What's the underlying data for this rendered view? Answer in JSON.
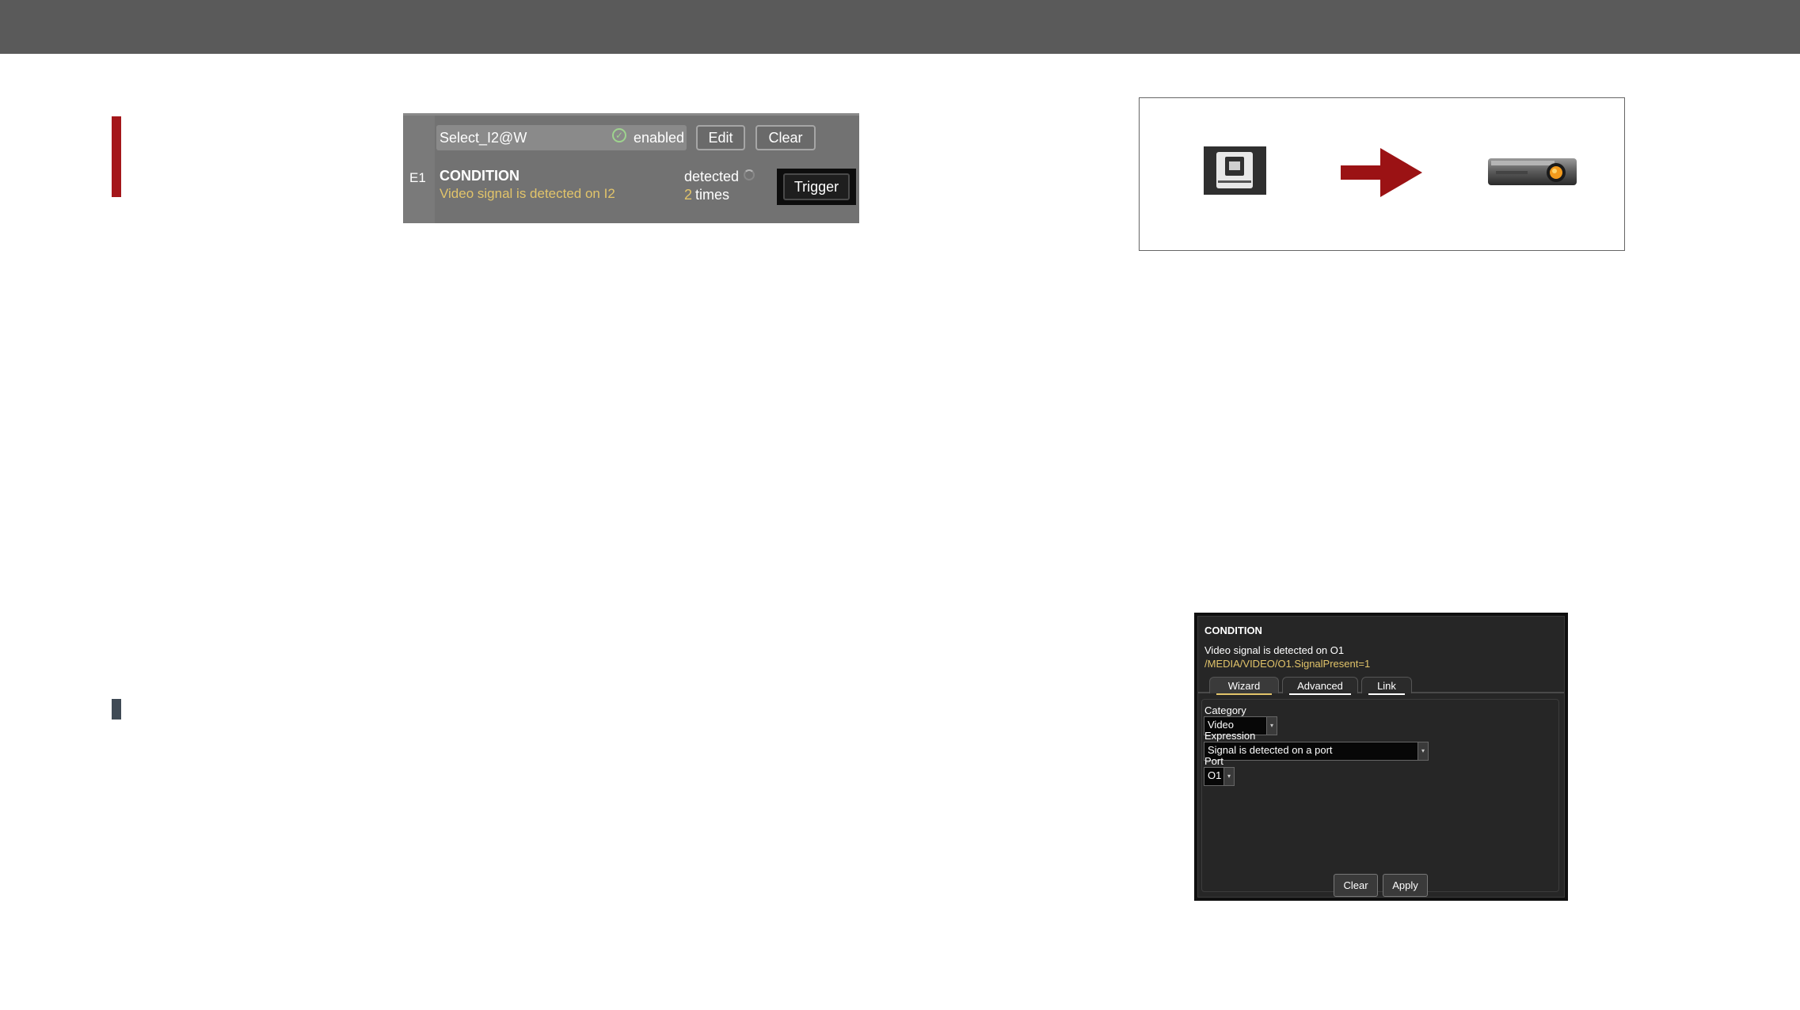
{
  "event_panel": {
    "event_name": "Select_I2@W",
    "status_label": "enabled",
    "edit_label": "Edit",
    "clear_label": "Clear",
    "event_id": "E1",
    "condition_title": "CONDITION",
    "condition_description": "Video signal is detected on I2",
    "detected_label": "detected",
    "detected_count": "2",
    "times_label": "times",
    "trigger_label": "Trigger"
  },
  "diagram": {
    "source_icon": "tps-rx-device-icon",
    "arrow_icon": "right-arrow-icon",
    "target_icon": "projector-icon",
    "arrow_color": "#9b1214"
  },
  "condition_editor": {
    "title": "CONDITION",
    "description": "Video signal is detected on O1",
    "expression_path": "/MEDIA/VIDEO/O1.SignalPresent=1",
    "tabs": [
      {
        "label": "Wizard",
        "active": true,
        "underline_color": "#e2c46a"
      },
      {
        "label": "Advanced",
        "active": false,
        "underline_color": "#ffffff"
      },
      {
        "label": "Link",
        "active": false,
        "underline_color": "#ffffff"
      }
    ],
    "category_label": "Category",
    "category_value": "Video",
    "expression_label": "Expression",
    "expression_value": "Signal is detected on a port",
    "port_label": "Port",
    "port_value": "O1",
    "clear_label": "Clear",
    "apply_label": "Apply"
  },
  "colors": {
    "accent_red": "#a4161a",
    "highlight_yellow": "#e2c46a"
  }
}
